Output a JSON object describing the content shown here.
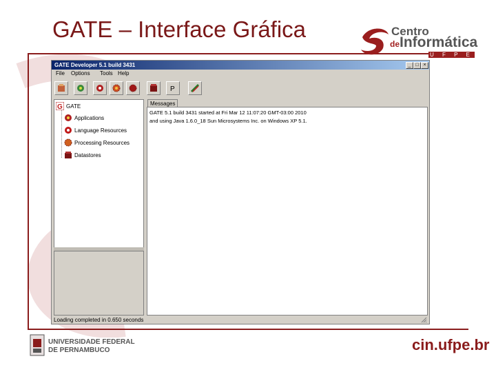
{
  "slide": {
    "title": "GATE – Interface Gráfica",
    "cin_logo": {
      "line1": "Centro",
      "de": "de",
      "line2": "Informática",
      "ufpe": "U F P E"
    },
    "footer": {
      "university_line1": "UNIVERSIDADE FEDERAL",
      "university_line2": "DE PERNAMBUCO",
      "site": "cin.ufpe.br"
    },
    "colors": {
      "brand_red": "#8a1c1c",
      "title_blue": "#0a246a"
    }
  },
  "window": {
    "title": "GATE Developer 5.1 build 3431",
    "controls": {
      "minimize": "_",
      "maximize": "□",
      "close": "×"
    },
    "menu": [
      "File",
      "Options",
      "Tools",
      "Help"
    ],
    "toolbar": [
      {
        "name": "load-application-icon"
      },
      {
        "name": "new-application-icon"
      },
      {
        "name": "new-language-resource-icon"
      },
      {
        "name": "new-processing-resource-icon"
      },
      {
        "name": "new-plugin-icon"
      },
      {
        "name": "new-datastore-icon"
      },
      {
        "name": "open-datastore-icon"
      },
      {
        "name": "annotation-diff-icon"
      }
    ],
    "tree": {
      "root": "GATE",
      "items": [
        {
          "label": "Applications",
          "icon": "applications-icon"
        },
        {
          "label": "Language Resources",
          "icon": "language-resources-icon"
        },
        {
          "label": "Processing Resources",
          "icon": "processing-resources-icon"
        },
        {
          "label": "Datastores",
          "icon": "datastores-icon"
        }
      ]
    },
    "messages_tab": "Messages",
    "messages": [
      "GATE 5.1 build 3431 started at Fri Mar 12 11:07:20 GMT-03:00 2010",
      "and using Java 1.6.0_18 Sun Microsystems Inc. on Windows XP 5.1."
    ],
    "status": "Loading completed in 0.650 seconds"
  }
}
